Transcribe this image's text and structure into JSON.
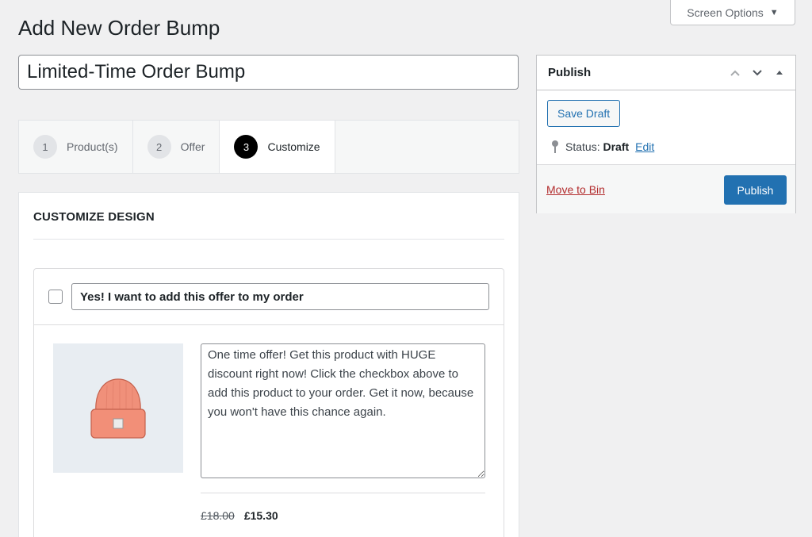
{
  "screen_options": {
    "label": "Screen Options",
    "caret": "▼"
  },
  "page_title": "Add New Order Bump",
  "post_title_value": "Limited-Time Order Bump",
  "steps": [
    {
      "num": "1",
      "label": "Product(s)"
    },
    {
      "num": "2",
      "label": "Offer"
    },
    {
      "num": "3",
      "label": "Customize"
    }
  ],
  "active_step": 3,
  "customize": {
    "heading": "CUSTOMIZE DESIGN",
    "bump_title_value": "Yes! I want to add this offer to my order",
    "description": "One time offer! Get this product with HUGE discount right now! Click the checkbox above to add this product to your order. Get it now, because you won't have this chance again.",
    "product_image_icon": "beanie-hat-image",
    "price_old": "£18.00",
    "price_new": "£15.30"
  },
  "publish": {
    "title": "Publish",
    "save_draft": "Save Draft",
    "status_label": "Status:",
    "status_value": "Draft",
    "edit_link": "Edit",
    "move_to_bin": "Move to Bin",
    "publish_button": "Publish"
  },
  "colors": {
    "primary": "#2271b1",
    "danger": "#b32d2e",
    "background": "#f0f0f1",
    "active_step": "#000000",
    "hat": "#f0907a"
  }
}
